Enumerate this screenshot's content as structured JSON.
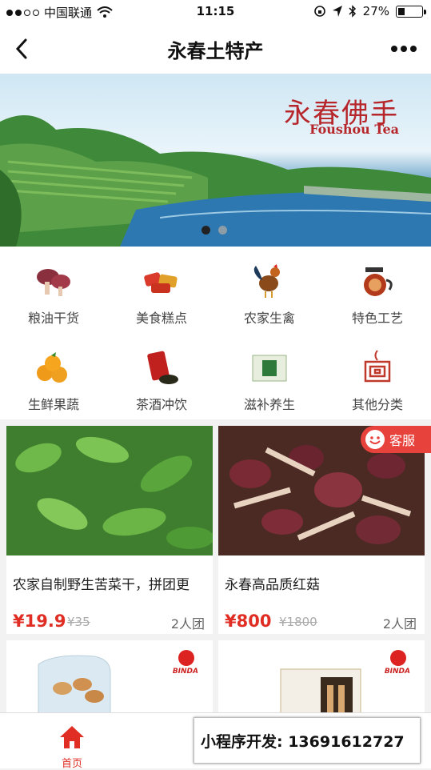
{
  "status_bar": {
    "carrier": "●●○○ 中国联通",
    "carrier_name": "中国联通",
    "time": "11:15",
    "battery": "27%"
  },
  "nav": {
    "title": "永春土特产"
  },
  "banner": {
    "brand_cn": "永春佛手",
    "brand_en": "Foushou Tea",
    "page_count": 2,
    "active_page": 1
  },
  "categories": [
    {
      "label": "粮油干货",
      "icon": "mushroom-icon"
    },
    {
      "label": "美食糕点",
      "icon": "snack-icon"
    },
    {
      "label": "农家生禽",
      "icon": "rooster-icon"
    },
    {
      "label": "特色工艺",
      "icon": "teapot-icon"
    },
    {
      "label": "生鲜果蔬",
      "icon": "orange-icon"
    },
    {
      "label": "茶酒冲饮",
      "icon": "tea-bag-icon"
    },
    {
      "label": "滋补养生",
      "icon": "health-box-icon"
    },
    {
      "label": "其他分类",
      "icon": "other-icon"
    }
  ],
  "products": [
    {
      "name": "农家自制野生苦菜干，拼团更",
      "price": "¥19.9",
      "original_price": "¥35",
      "group": "2人团"
    },
    {
      "name": "永春高品质红菇",
      "price": "¥800",
      "original_price": "¥1800",
      "group": "2人团"
    }
  ],
  "lower_cards": [
    {
      "brand": "BINDA"
    },
    {
      "brand": "BINDA"
    }
  ],
  "customer_service": {
    "label": "客服"
  },
  "tabbar": {
    "home_label": "首页"
  },
  "promo": {
    "text": "小程序开发: 13691612727"
  },
  "colors": {
    "accent": "#e02e24",
    "service": "#e8423d"
  }
}
